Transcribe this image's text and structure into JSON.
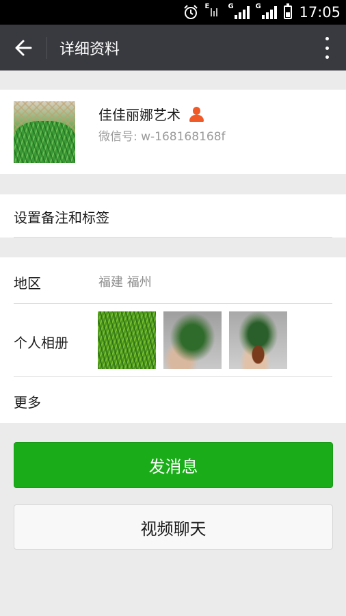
{
  "status_bar": {
    "time": "17:05",
    "network_1": "E",
    "network_2": "G",
    "icons": [
      "alarm-icon",
      "signal-icon",
      "signal-icon",
      "battery-icon"
    ]
  },
  "app_bar": {
    "title": "详细资料",
    "back_icon": "arrow-left-icon",
    "more_icon": "more-vertical-icon"
  },
  "profile": {
    "name": "佳佳丽娜艺术",
    "wechat_id": "微信号: w-168168168f",
    "gender_icon": "person-icon"
  },
  "remark": {
    "label": "设置备注和标签"
  },
  "info": {
    "region_label": "地区",
    "region_value": "福建  福州",
    "album_label": "个人相册",
    "more_label": "更多"
  },
  "actions": {
    "send_message": "发消息",
    "video_chat": "视频聊天"
  },
  "colors": {
    "app_bar": "#393a3f",
    "primary_button": "#1aad19",
    "gender_icon": "#f05a28",
    "background": "#ebebeb"
  }
}
